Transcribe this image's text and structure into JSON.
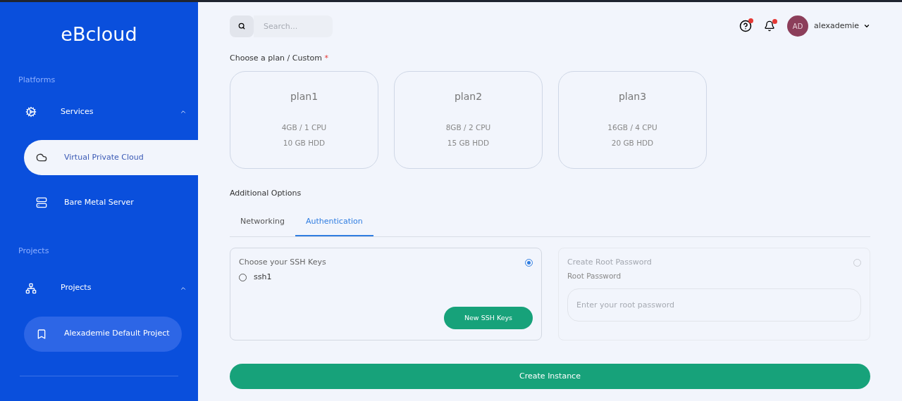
{
  "sidebar": {
    "logo": "eBcloud",
    "sections": [
      {
        "title": "Platforms",
        "items": [
          {
            "label": "Services",
            "expanded": true,
            "children": [
              {
                "label": "Virtual Private Cloud",
                "selected": true,
                "highlighted": false
              },
              {
                "label": "Bare Metal Server",
                "selected": false,
                "highlighted": false
              }
            ]
          }
        ]
      },
      {
        "title": "Projects",
        "items": [
          {
            "label": "Projects",
            "expanded": true,
            "children": [
              {
                "label": "Alexademie Default Project",
                "selected": false,
                "highlighted": true
              }
            ]
          }
        ]
      }
    ]
  },
  "header": {
    "search": {
      "placeholder": "Search..."
    },
    "help_badge": true,
    "notification_badge": true,
    "user": {
      "initials": "AD",
      "name": "alexademie"
    }
  },
  "plans": {
    "label": "Choose a plan / Custom",
    "required_mark": "*",
    "items": [
      {
        "name": "plan1",
        "specs": [
          "4GB / 1 CPU",
          "10 GB HDD"
        ]
      },
      {
        "name": "plan2",
        "specs": [
          "8GB / 2 CPU",
          "15 GB HDD"
        ]
      },
      {
        "name": "plan3",
        "specs": [
          "16GB / 4 CPU",
          "20 GB HDD"
        ]
      }
    ]
  },
  "additional": {
    "title": "Additional Options",
    "tabs": [
      {
        "label": "Networking",
        "selected": false
      },
      {
        "label": "Authentication",
        "selected": true
      }
    ],
    "options": [
      {
        "kind": "ssh",
        "title": "Choose your SSH Keys",
        "selected": true,
        "keys": [
          {
            "label": "ssh1",
            "checked": false
          }
        ],
        "button": "New SSH Keys"
      },
      {
        "kind": "password",
        "title": "Create Root Password",
        "selected": false,
        "field_label": "Root Password",
        "placeholder": "Enter your root password"
      }
    ]
  },
  "submit": "Create Instance"
}
